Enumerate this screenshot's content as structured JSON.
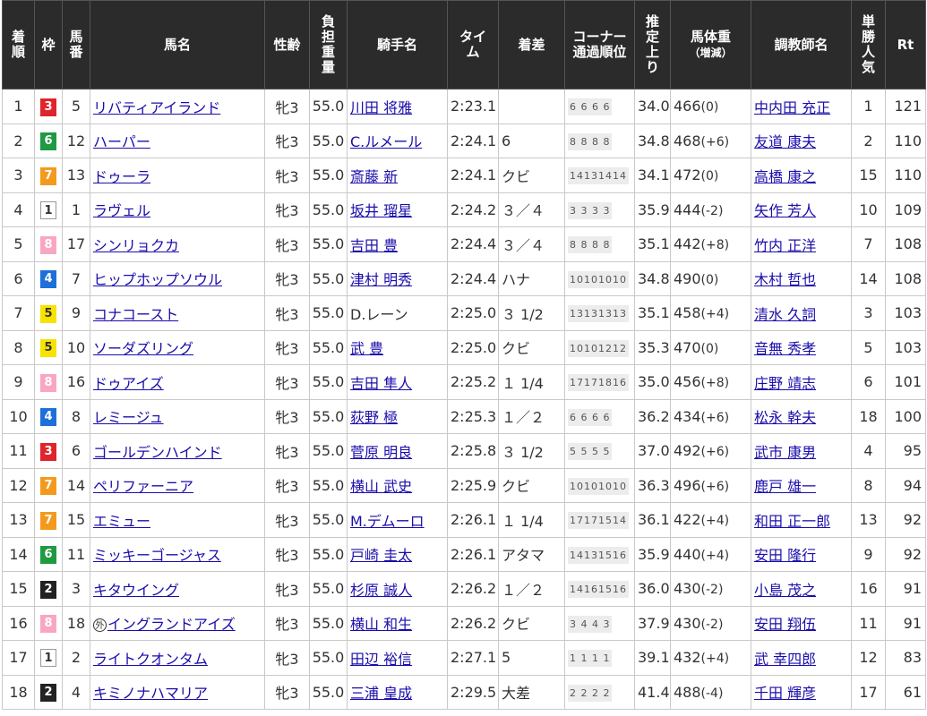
{
  "headers": {
    "rank": [
      "着",
      "順"
    ],
    "waku": "枠",
    "umaban": [
      "馬",
      "番"
    ],
    "horse": "馬名",
    "sexage": "性齢",
    "weight": [
      "負",
      "担",
      "重",
      "量"
    ],
    "jockey": "騎手名",
    "time": [
      "タイ",
      "ム"
    ],
    "margin": "着差",
    "corner": [
      "コーナー",
      "通過順位"
    ],
    "last": [
      "推",
      "定",
      "上",
      "り"
    ],
    "bodyweight": [
      "馬体重",
      "（増減）"
    ],
    "trainer": "調教師名",
    "pop": [
      "単",
      "勝",
      "人",
      "気"
    ],
    "rating": "Rt"
  },
  "colors": {
    "header_bg": "#2b2b2b",
    "link": "#1a0dab",
    "waku_1": "#ffffff",
    "waku_2": "#222222",
    "waku_3": "#e0242b",
    "waku_4": "#1e6fd9",
    "waku_5": "#f7e300",
    "waku_6": "#1f9a43",
    "waku_7": "#f39a1e",
    "waku_8": "#f9a6c3"
  },
  "rows": [
    {
      "rank": "1",
      "waku": "3",
      "umaban": "5",
      "gai": "",
      "horse": "リバティアイランド",
      "sexage": "牝3",
      "weight": "55.0",
      "jockey": "川田 将雅",
      "jockey_link": true,
      "time": "2:23.1",
      "margin": "",
      "corner": "6 6 6 6",
      "last": "34.0",
      "bw": "466",
      "bwd": "(0)",
      "trainer": "中内田 充正",
      "pop": "1",
      "rt": "121"
    },
    {
      "rank": "2",
      "waku": "6",
      "umaban": "12",
      "gai": "",
      "horse": "ハーパー",
      "sexage": "牝3",
      "weight": "55.0",
      "jockey": "C.ルメール",
      "jockey_link": true,
      "time": "2:24.1",
      "margin": "6",
      "corner": "8 8 8 8",
      "last": "34.8",
      "bw": "468",
      "bwd": "(+6)",
      "trainer": "友道 康夫",
      "pop": "2",
      "rt": "110"
    },
    {
      "rank": "3",
      "waku": "7",
      "umaban": "13",
      "gai": "",
      "horse": "ドゥーラ",
      "sexage": "牝3",
      "weight": "55.0",
      "jockey": "斎藤 新",
      "jockey_link": true,
      "time": "2:24.1",
      "margin": "クビ",
      "corner": "14131414",
      "last": "34.1",
      "bw": "472",
      "bwd": "(0)",
      "trainer": "高橋 康之",
      "pop": "15",
      "rt": "110"
    },
    {
      "rank": "4",
      "waku": "1",
      "umaban": "1",
      "gai": "",
      "horse": "ラヴェル",
      "sexage": "牝3",
      "weight": "55.0",
      "jockey": "坂井 瑠星",
      "jockey_link": true,
      "time": "2:24.2",
      "margin": "３／４",
      "corner": "3 3 3 3",
      "last": "35.9",
      "bw": "444",
      "bwd": "(-2)",
      "trainer": "矢作 芳人",
      "pop": "10",
      "rt": "109"
    },
    {
      "rank": "5",
      "waku": "8",
      "umaban": "17",
      "gai": "",
      "horse": "シンリョクカ",
      "sexage": "牝3",
      "weight": "55.0",
      "jockey": "吉田 豊",
      "jockey_link": true,
      "time": "2:24.4",
      "margin": "３／４",
      "corner": "8 8 8 8",
      "last": "35.1",
      "bw": "442",
      "bwd": "(+8)",
      "trainer": "竹内 正洋",
      "pop": "7",
      "rt": "108"
    },
    {
      "rank": "6",
      "waku": "4",
      "umaban": "7",
      "gai": "",
      "horse": "ヒップホップソウル",
      "sexage": "牝3",
      "weight": "55.0",
      "jockey": "津村 明秀",
      "jockey_link": true,
      "time": "2:24.4",
      "margin": "ハナ",
      "corner": "10101010",
      "last": "34.8",
      "bw": "490",
      "bwd": "(0)",
      "trainer": "木村 哲也",
      "pop": "14",
      "rt": "108"
    },
    {
      "rank": "7",
      "waku": "5",
      "umaban": "9",
      "gai": "",
      "horse": "コナコースト",
      "sexage": "牝3",
      "weight": "55.0",
      "jockey": "D.レーン",
      "jockey_link": false,
      "time": "2:25.0",
      "margin": "３ 1/2",
      "corner": "13131313",
      "last": "35.1",
      "bw": "458",
      "bwd": "(+4)",
      "trainer": "清水 久詞",
      "pop": "3",
      "rt": "103"
    },
    {
      "rank": "8",
      "waku": "5",
      "umaban": "10",
      "gai": "",
      "horse": "ソーダズリング",
      "sexage": "牝3",
      "weight": "55.0",
      "jockey": "武 豊",
      "jockey_link": true,
      "time": "2:25.0",
      "margin": "クビ",
      "corner": "10101212",
      "last": "35.3",
      "bw": "470",
      "bwd": "(0)",
      "trainer": "音無 秀孝",
      "pop": "5",
      "rt": "103"
    },
    {
      "rank": "9",
      "waku": "8",
      "umaban": "16",
      "gai": "",
      "horse": "ドゥアイズ",
      "sexage": "牝3",
      "weight": "55.0",
      "jockey": "吉田 隼人",
      "jockey_link": true,
      "time": "2:25.2",
      "margin": "１ 1/4",
      "corner": "17171816",
      "last": "35.0",
      "bw": "456",
      "bwd": "(+8)",
      "trainer": "庄野 靖志",
      "pop": "6",
      "rt": "101"
    },
    {
      "rank": "10",
      "waku": "4",
      "umaban": "8",
      "gai": "",
      "horse": "レミージュ",
      "sexage": "牝3",
      "weight": "55.0",
      "jockey": "荻野 極",
      "jockey_link": true,
      "time": "2:25.3",
      "margin": "１／２",
      "corner": "6 6 6 6",
      "last": "36.2",
      "bw": "434",
      "bwd": "(+6)",
      "trainer": "松永 幹夫",
      "pop": "18",
      "rt": "100"
    },
    {
      "rank": "11",
      "waku": "3",
      "umaban": "6",
      "gai": "",
      "horse": "ゴールデンハインド",
      "sexage": "牝3",
      "weight": "55.0",
      "jockey": "菅原 明良",
      "jockey_link": true,
      "time": "2:25.8",
      "margin": "３ 1/2",
      "corner": "5 5 5 5",
      "last": "37.0",
      "bw": "492",
      "bwd": "(+6)",
      "trainer": "武市 康男",
      "pop": "4",
      "rt": "95"
    },
    {
      "rank": "12",
      "waku": "7",
      "umaban": "14",
      "gai": "",
      "horse": "ペリファーニア",
      "sexage": "牝3",
      "weight": "55.0",
      "jockey": "横山 武史",
      "jockey_link": true,
      "time": "2:25.9",
      "margin": "クビ",
      "corner": "10101010",
      "last": "36.3",
      "bw": "496",
      "bwd": "(+6)",
      "trainer": "鹿戸 雄一",
      "pop": "8",
      "rt": "94"
    },
    {
      "rank": "13",
      "waku": "7",
      "umaban": "15",
      "gai": "",
      "horse": "エミュー",
      "sexage": "牝3",
      "weight": "55.0",
      "jockey": "M.デムーロ",
      "jockey_link": true,
      "time": "2:26.1",
      "margin": "１ 1/4",
      "corner": "17171514",
      "last": "36.1",
      "bw": "422",
      "bwd": "(+4)",
      "trainer": "和田 正一郎",
      "pop": "13",
      "rt": "92"
    },
    {
      "rank": "14",
      "waku": "6",
      "umaban": "11",
      "gai": "",
      "horse": "ミッキーゴージャス",
      "sexage": "牝3",
      "weight": "55.0",
      "jockey": "戸崎 圭太",
      "jockey_link": true,
      "time": "2:26.1",
      "margin": "アタマ",
      "corner": "14131516",
      "last": "35.9",
      "bw": "440",
      "bwd": "(+4)",
      "trainer": "安田 隆行",
      "pop": "9",
      "rt": "92"
    },
    {
      "rank": "15",
      "waku": "2",
      "umaban": "3",
      "gai": "",
      "horse": "キタウイング",
      "sexage": "牝3",
      "weight": "55.0",
      "jockey": "杉原 誠人",
      "jockey_link": true,
      "time": "2:26.2",
      "margin": "１／２",
      "corner": "14161516",
      "last": "36.0",
      "bw": "430",
      "bwd": "(-2)",
      "trainer": "小島 茂之",
      "pop": "16",
      "rt": "91"
    },
    {
      "rank": "16",
      "waku": "8",
      "umaban": "18",
      "gai": "外",
      "horse": "イングランドアイズ",
      "sexage": "牝3",
      "weight": "55.0",
      "jockey": "横山 和生",
      "jockey_link": true,
      "time": "2:26.2",
      "margin": "クビ",
      "corner": "3 4 4 3",
      "last": "37.9",
      "bw": "430",
      "bwd": "(-2)",
      "trainer": "安田 翔伍",
      "pop": "11",
      "rt": "91"
    },
    {
      "rank": "17",
      "waku": "1",
      "umaban": "2",
      "gai": "",
      "horse": "ライトクオンタム",
      "sexage": "牝3",
      "weight": "55.0",
      "jockey": "田辺 裕信",
      "jockey_link": true,
      "time": "2:27.1",
      "margin": "5",
      "corner": "1 1 1 1",
      "last": "39.1",
      "bw": "432",
      "bwd": "(+4)",
      "trainer": "武 幸四郎",
      "pop": "12",
      "rt": "83"
    },
    {
      "rank": "18",
      "waku": "2",
      "umaban": "4",
      "gai": "",
      "horse": "キミノナハマリア",
      "sexage": "牝3",
      "weight": "55.0",
      "jockey": "三浦 皇成",
      "jockey_link": true,
      "time": "2:29.5",
      "margin": "大差",
      "corner": "2 2 2 2",
      "last": "41.4",
      "bw": "488",
      "bwd": "(-4)",
      "trainer": "千田 輝彦",
      "pop": "17",
      "rt": "61"
    }
  ]
}
